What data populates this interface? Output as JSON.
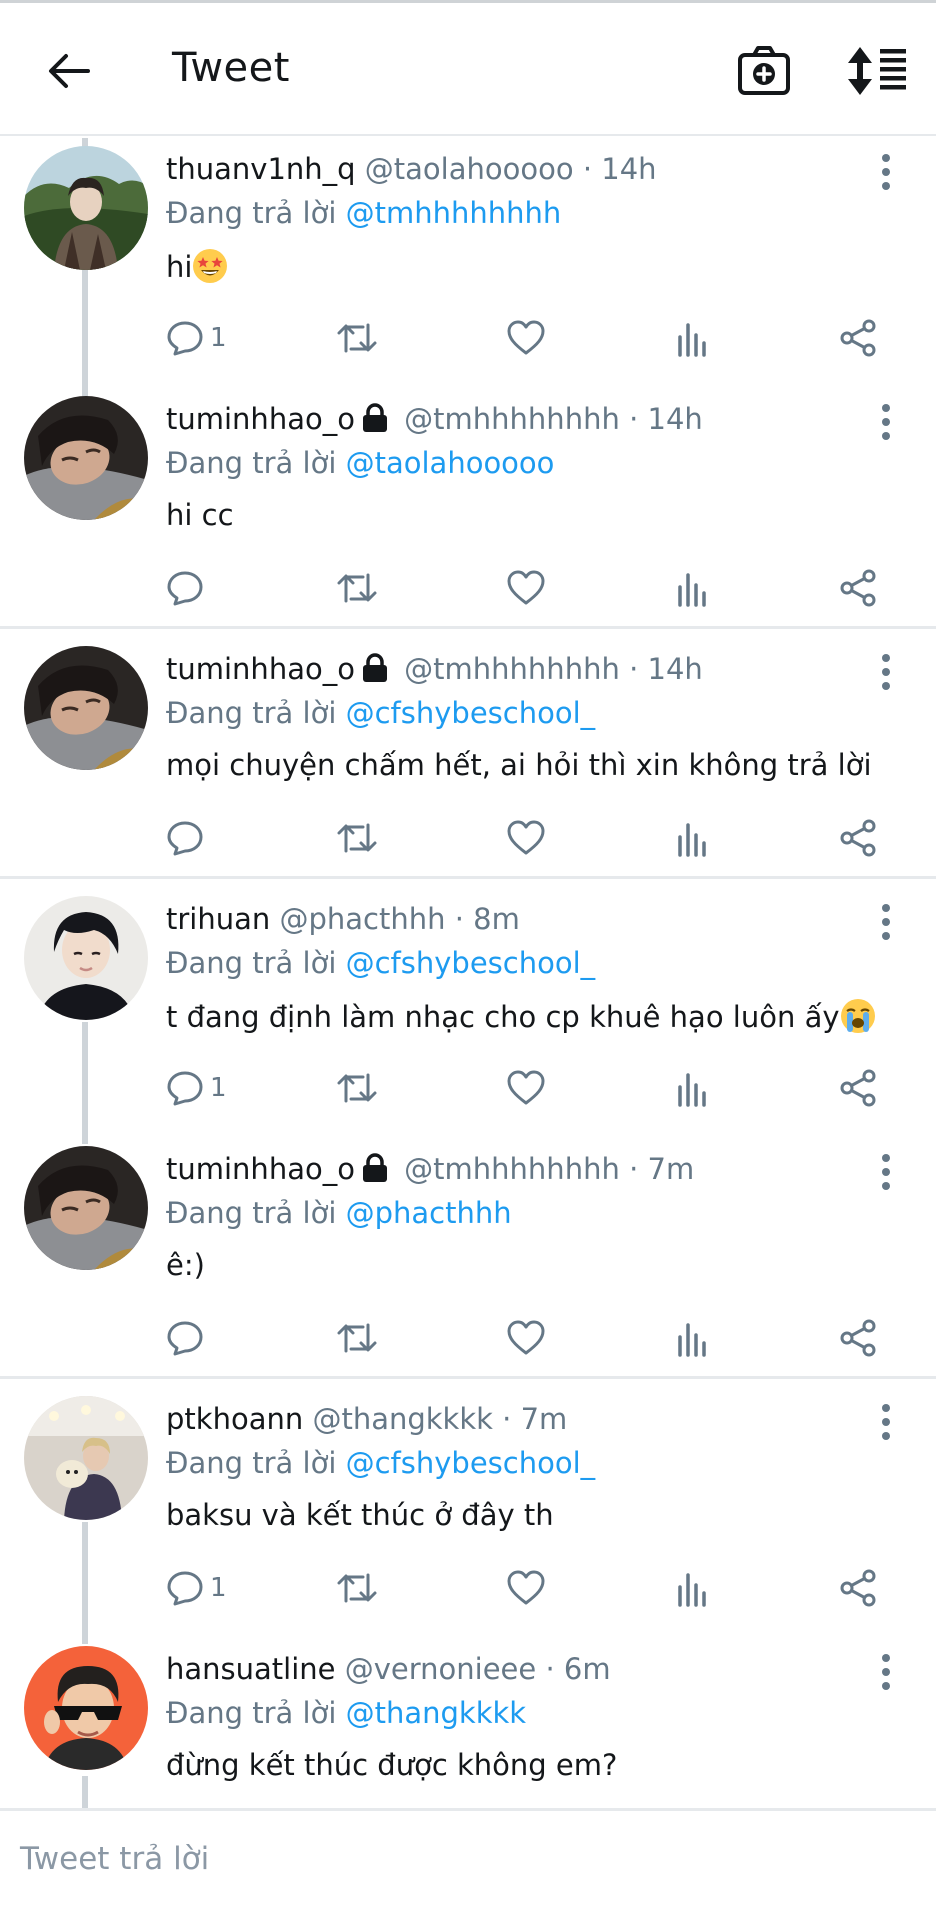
{
  "header": {
    "title": "Tweet"
  },
  "reply_prefix": "Đang trả lời",
  "tweets": [
    {
      "name": "thuanv1nh_q",
      "handle": "@taolahooooo",
      "time": "· 14h",
      "locked": false,
      "reply_to": "@tmhhhhhhhh",
      "text": "hi",
      "emoji": "star-struck-emoji",
      "reply_count": "1"
    },
    {
      "name": "tuminhhao_o",
      "handle": "@tmhhhhhhhh",
      "time": "· 14h",
      "locked": true,
      "reply_to": "@taolahooooo",
      "text": "hi cc",
      "reply_count": ""
    },
    {
      "name": "tuminhhao_o",
      "handle": "@tmhhhhhhhh",
      "time": "· 14h",
      "locked": true,
      "reply_to": "@cfshybeschool_",
      "text": "mọi chuyện chấm hết, ai hỏi thì xin không trả lời",
      "reply_count": ""
    },
    {
      "name": "trihuan",
      "handle": "@phacthhh",
      "time": "· 8m",
      "locked": false,
      "reply_to": "@cfshybeschool_",
      "text": "t đang định làm nhạc cho cp khuê hạo luôn ấy",
      "emoji": "loudly-crying-emoji",
      "reply_count": "1"
    },
    {
      "name": "tuminhhao_o",
      "handle": "@tmhhhhhhhh",
      "time": "· 7m",
      "locked": true,
      "reply_to": "@phacthhh",
      "text": "ê:)",
      "reply_count": ""
    },
    {
      "name": "ptkhoann",
      "handle": "@thangkkkk",
      "time": "· 7m",
      "locked": false,
      "reply_to": "@cfshybeschool_",
      "text": "baksu và kết thúc ở đây th",
      "reply_count": "1"
    },
    {
      "name": "hansuatline",
      "handle": "@vernonieee",
      "time": "· 6m",
      "locked": false,
      "reply_to": "@thangkkkk",
      "text": "đừng kết thúc được không em?",
      "reply_count": ""
    }
  ],
  "composer": {
    "placeholder": "Tweet trả lời"
  },
  "colors": {
    "link": "#1d9bf0",
    "muted": "#657786",
    "divider": "#e6e9ec",
    "thread_line": "#ced4d9"
  }
}
